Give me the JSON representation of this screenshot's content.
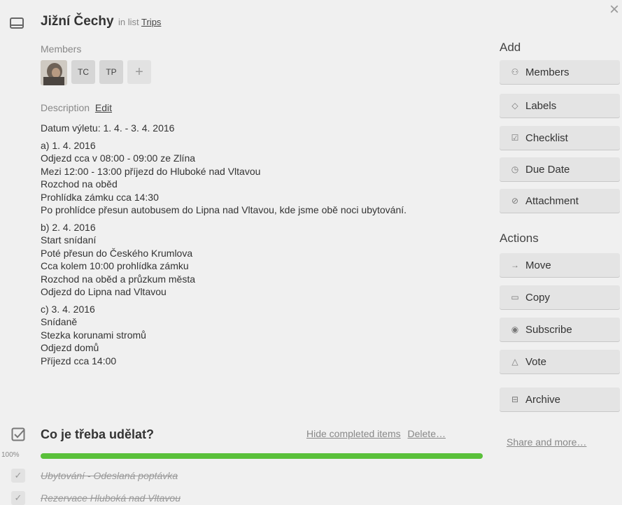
{
  "card": {
    "title": "Jižní Čechy",
    "in_list_prefix": "in list",
    "list_name": "Trips",
    "close_icon": "close-icon"
  },
  "members": {
    "label": "Members",
    "initials": [
      "TC",
      "TP"
    ],
    "add_symbol": "+"
  },
  "description": {
    "label": "Description",
    "edit_label": "Edit",
    "paragraphs": [
      [
        "Datum výletu: 1. 4. - 3. 4. 2016"
      ],
      [
        "a) 1. 4. 2016",
        "Odjezd cca v 08:00 - 09:00 ze Zlína",
        "Mezi 12:00 - 13:00 příjezd do Hluboké nad Vltavou",
        "Rozchod na oběd",
        "Prohlídka zámku cca 14:30",
        "Po prohlídce přesun autobusem do Lipna nad Vltavou, kde jsme obě noci ubytování."
      ],
      [
        "b) 2. 4. 2016",
        "Start snídaní",
        "Poté přesun do Českého Krumlova",
        "Cca kolem 10:00 prohlídka zámku",
        "Rozchod na oběd a průzkum města",
        "Odjezd do Lipna nad Vltavou"
      ],
      [
        "c) 3. 4. 2016",
        "Snídaně",
        "Stezka korunami stromů",
        "Odjezd domů",
        "Příjezd cca 14:00"
      ]
    ]
  },
  "sidebar": {
    "add_heading": "Add",
    "add_buttons": [
      {
        "label": "Members",
        "icon": "person-icon",
        "glyph": "⚇"
      },
      {
        "label": "Labels",
        "icon": "tag-icon",
        "glyph": "◇"
      },
      {
        "label": "Checklist",
        "icon": "checklist-icon",
        "glyph": "☑"
      },
      {
        "label": "Due Date",
        "icon": "clock-icon",
        "glyph": "◷"
      },
      {
        "label": "Attachment",
        "icon": "paperclip-icon",
        "glyph": "⊘"
      }
    ],
    "actions_heading": "Actions",
    "action_buttons": [
      {
        "label": "Move",
        "icon": "arrow-right-icon",
        "glyph": "→"
      },
      {
        "label": "Copy",
        "icon": "copy-icon",
        "glyph": "▭"
      },
      {
        "label": "Subscribe",
        "icon": "eye-icon",
        "glyph": "◉"
      },
      {
        "label": "Vote",
        "icon": "thumbs-up-icon",
        "glyph": "△"
      },
      {
        "label": "Archive",
        "icon": "archive-icon",
        "glyph": "⊟"
      }
    ],
    "share_label": "Share and more…"
  },
  "checklist": {
    "title": "Co je třeba udělat?",
    "hide_label": "Hide completed items",
    "delete_label": "Delete…",
    "percent_label": "100%",
    "progress": 1.0,
    "progress_color": "#5ac03a",
    "items": [
      {
        "text": "Ubytování - Odeslaná poptávka",
        "done": true
      },
      {
        "text": "Rezervace Hluboká nad Vltavou",
        "done": true
      }
    ]
  }
}
